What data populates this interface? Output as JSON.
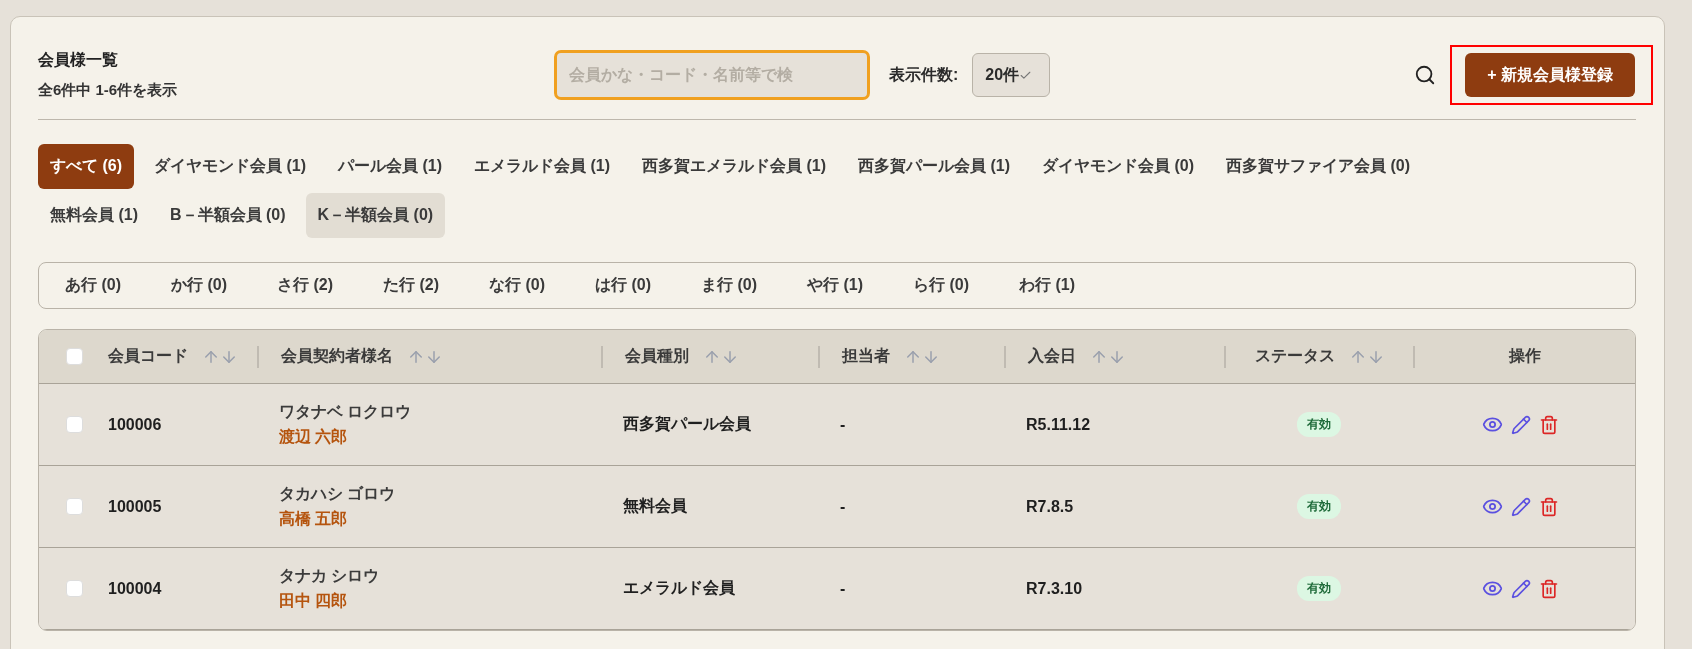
{
  "header": {
    "title": "会員様一覧",
    "summary": "全6件中 1-6件を表示"
  },
  "search": {
    "placeholder": "会員かな・コード・名前等で検",
    "focused": true
  },
  "page_size": {
    "label": "表示件数:",
    "value": "20件"
  },
  "new_button": {
    "label": "+ 新規会員様登録",
    "highlighted": true
  },
  "category_tabs": [
    {
      "label": "すべて (6)",
      "selected": true,
      "hovered": false
    },
    {
      "label": "ダイヤモンド会員 (1)",
      "selected": false,
      "hovered": false
    },
    {
      "label": "パール会員 (1)",
      "selected": false,
      "hovered": false
    },
    {
      "label": "エメラルド会員 (1)",
      "selected": false,
      "hovered": false
    },
    {
      "label": "西多賀エメラルド会員 (1)",
      "selected": false,
      "hovered": false
    },
    {
      "label": "西多賀パール会員 (1)",
      "selected": false,
      "hovered": false
    },
    {
      "label": "ダイヤモンド会員 (0)",
      "selected": false,
      "hovered": false
    },
    {
      "label": "西多賀サファイア会員 (0)",
      "selected": false,
      "hovered": false
    },
    {
      "label": "無料会員 (1)",
      "selected": false,
      "hovered": false
    },
    {
      "label": "B－半額会員 (0)",
      "selected": false,
      "hovered": false
    },
    {
      "label": "K－半額会員 (0)",
      "selected": false,
      "hovered": true
    }
  ],
  "kana_tabs": [
    "あ行 (0)",
    "か行 (0)",
    "さ行 (2)",
    "た行 (2)",
    "な行 (0)",
    "は行 (0)",
    "ま行 (0)",
    "や行 (1)",
    "ら行 (0)",
    "わ行 (1)"
  ],
  "table": {
    "select_all_checked": false,
    "columns": [
      {
        "label": "会員コード",
        "sortable": true
      },
      {
        "label": "会員契約者様名",
        "sortable": true
      },
      {
        "label": "会員種別",
        "sortable": true
      },
      {
        "label": "担当者",
        "sortable": true
      },
      {
        "label": "入会日",
        "sortable": true
      },
      {
        "label": "ステータス",
        "sortable": true
      },
      {
        "label": "操作",
        "sortable": false
      }
    ],
    "rows": [
      {
        "checked": false,
        "code": "100006",
        "kana": "ワタナベ ロクロウ",
        "name": "渡辺 六郎",
        "type": "西多賀パール会員",
        "staff": "-",
        "joined": "R5.11.12",
        "status": "有効"
      },
      {
        "checked": false,
        "code": "100005",
        "kana": "タカハシ ゴロウ",
        "name": "高橋 五郎",
        "type": "無料会員",
        "staff": "-",
        "joined": "R7.8.5",
        "status": "有効"
      },
      {
        "checked": false,
        "code": "100004",
        "kana": "タナカ シロウ",
        "name": "田中 四郎",
        "type": "エメラルド会員",
        "staff": "-",
        "joined": "R7.3.10",
        "status": "有効"
      }
    ]
  }
}
